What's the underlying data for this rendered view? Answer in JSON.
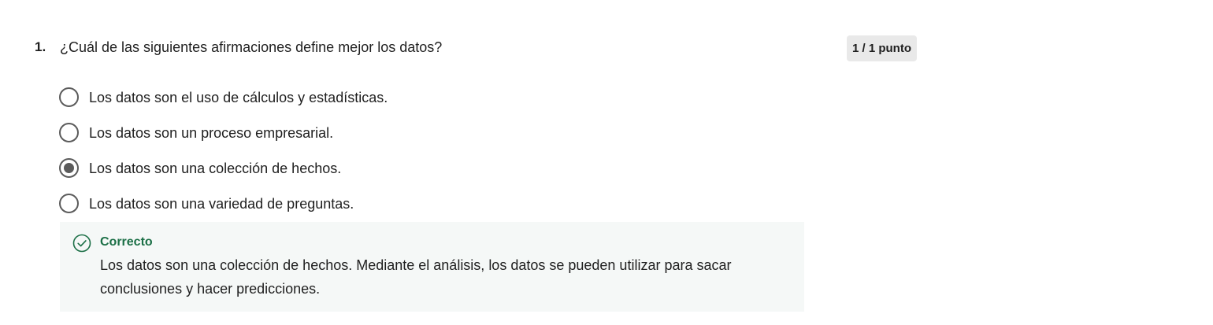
{
  "question": {
    "number": "1.",
    "text": "¿Cuál de las siguientes afirmaciones define mejor los datos?",
    "score": "1 / 1 punto"
  },
  "options": [
    {
      "label": "Los datos son el uso de cálculos y estadísticas.",
      "selected": false
    },
    {
      "label": "Los datos son un proceso empresarial.",
      "selected": false
    },
    {
      "label": "Los datos son una colección de hechos.",
      "selected": true
    },
    {
      "label": "Los datos son una variedad de preguntas.",
      "selected": false
    }
  ],
  "feedback": {
    "status": "Correcto",
    "icon": "check-circle-icon",
    "text": "Los datos son una colección de hechos. Mediante el análisis, los datos se pueden utilizar para sacar conclusiones y hacer predicciones."
  },
  "colors": {
    "correct_green": "#1b6f46",
    "radio_gray": "#5b5b5b",
    "badge_bg": "#e9e9e9",
    "feedback_bg": "#f5f8f7"
  }
}
